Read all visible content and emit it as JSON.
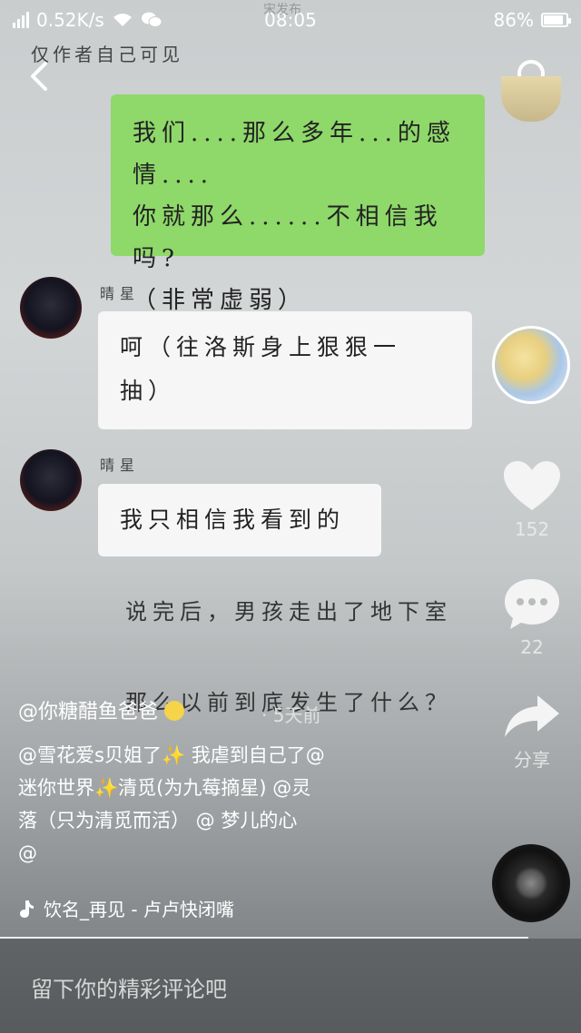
{
  "status_bar": {
    "network_speed": "0.52K/s",
    "time": "08:05",
    "battery": "86%",
    "battery_level": 0.86
  },
  "video": {
    "top_note": "仅作者自己可见",
    "top_faded": "宋发布",
    "bubble_green": [
      "我们....那么多年...的感情....",
      "你就那么......不相信我吗?",
      "（非常虚弱）"
    ],
    "sender_1": "晴星",
    "bubble_white_1": [
      "呵（往洛斯身上狠狠一",
      "抽）"
    ],
    "sender_2": "晴星",
    "bubble_white_2": "我只相信我看到的",
    "narration_1": "说完后，男孩走出了地下室",
    "narration_2": "那么以前到底发生了什么？"
  },
  "actions": {
    "like_count": "152",
    "comment_count": "22",
    "share_label": "分享"
  },
  "post": {
    "author": "@你糖醋鱼爸爸",
    "time_ago": "· 5天前",
    "caption_lines": [
      "@雪花爱s贝姐了✨ 我虐到自己了@",
      "迷你世界✨清觅(为九莓摘星) @灵",
      "落（只为清觅而活） @  梦儿的心",
      "@"
    ],
    "music": "饮名_再见 - 卢卢快闭嘴"
  },
  "comment_input": {
    "placeholder": "留下你的精彩评论吧"
  },
  "icons": {
    "back": "back-arrow-icon",
    "search": "search-icon",
    "like": "heart-icon",
    "comment": "comment-bubble-icon",
    "share": "share-arrow-icon",
    "music": "music-note-icon"
  },
  "colors": {
    "green_bubble": "#8fd86a",
    "white_bubble": "#f6f6f6"
  }
}
